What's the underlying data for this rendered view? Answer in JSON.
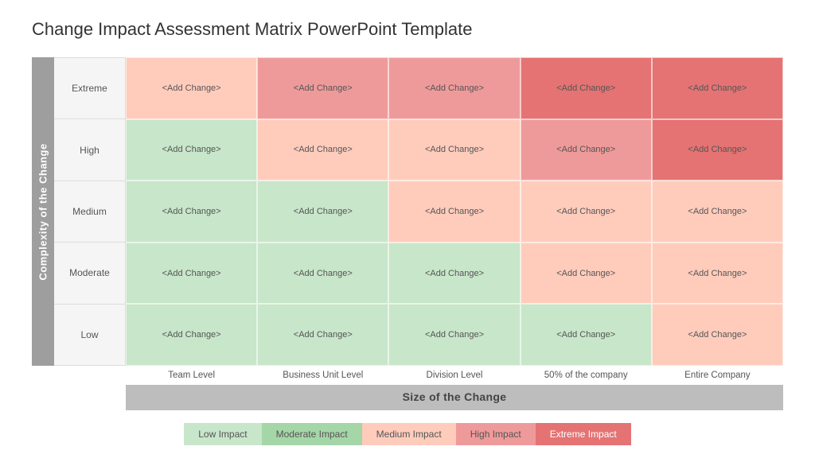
{
  "title": "Change Impact Assessment Matrix PowerPoint Template",
  "yAxis": {
    "label": "Complexity of the Change"
  },
  "xAxis": {
    "label": "Size of the Change"
  },
  "rowLabels": [
    "Extreme",
    "High",
    "Medium",
    "Moderate",
    "Low"
  ],
  "colHeaders": [
    "Team Level",
    "Business Unit Level",
    "Division Level",
    "50% of the company",
    "Entire Company"
  ],
  "cellText": "<Add Change>",
  "grid": [
    [
      "light-salmon",
      "salmon",
      "salmon",
      "red",
      "red"
    ],
    [
      "light-green",
      "light-salmon",
      "light-salmon",
      "salmon",
      "red"
    ],
    [
      "light-green",
      "light-green",
      "light-salmon",
      "light-salmon",
      "light-salmon"
    ],
    [
      "light-green",
      "light-green",
      "light-green",
      "light-salmon",
      "light-salmon"
    ],
    [
      "light-green",
      "light-green",
      "light-green",
      "light-green",
      "light-salmon"
    ]
  ],
  "legend": [
    {
      "key": "li-low",
      "label": "Low Impact"
    },
    {
      "key": "li-moderate",
      "label": "Moderate Impact"
    },
    {
      "key": "li-medium",
      "label": "Medium Impact"
    },
    {
      "key": "li-high",
      "label": "High Impact"
    },
    {
      "key": "li-extreme",
      "label": "Extreme Impact"
    }
  ]
}
